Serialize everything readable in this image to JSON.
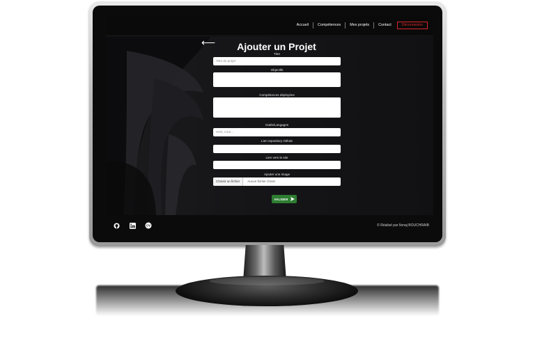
{
  "nav": {
    "items": [
      "Accueil",
      "Compétences",
      "Mes projets",
      "Contact"
    ],
    "logout": "Déconnexion"
  },
  "form": {
    "title": "Ajouter un Projet",
    "back_icon": "arrow-left-icon",
    "fields": [
      {
        "label": "Titre",
        "placeholder": "Titre du projet"
      },
      {
        "label": "Objectifs",
        "placeholder": ""
      },
      {
        "label": "Compétences déployées",
        "placeholder": ""
      },
      {
        "label": "Outils/Langages",
        "placeholder": "Html, CSS..."
      },
      {
        "label": "Lien repository Github",
        "placeholder": ""
      },
      {
        "label": "Lien vers le site",
        "placeholder": ""
      },
      {
        "label": "Ajouter une image",
        "file_button": "Choisir un fichier",
        "file_status": "Aucun fichier choisi"
      }
    ],
    "submit_label": "VALIDER",
    "submit_icon": "send-icon",
    "submit_color": "#2e7d32"
  },
  "footer": {
    "icons": [
      "github-icon",
      "linkedin-icon",
      "cv-icon"
    ],
    "cv_label": "CV",
    "copyright": "© Réalisé par Ilonaj BOUCHRAIB"
  },
  "colors": {
    "accent_logout": "#d9252b",
    "background": "#0d0d0e"
  }
}
